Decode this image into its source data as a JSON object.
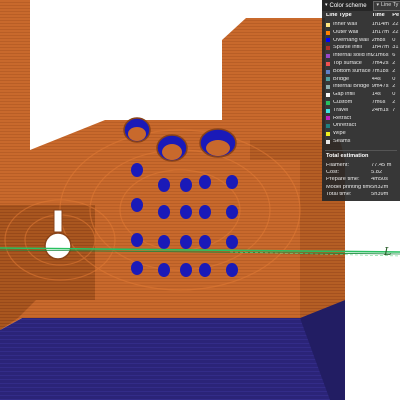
{
  "legend": {
    "title": "Color scheme",
    "selector_value": "Line Ty",
    "columns": [
      "Line Type",
      "Time",
      "Pe"
    ],
    "items": [
      {
        "label": "Inner wall",
        "time": "1h14m",
        "pct": "22",
        "color": "#ffe680"
      },
      {
        "label": "Outer wall",
        "time": "1h17m",
        "pct": "22",
        "color": "#ff7f00"
      },
      {
        "label": "Overhang wall",
        "time": "2m8s",
        "pct": "0",
        "color": "#0000ff"
      },
      {
        "label": "Sparse infill",
        "time": "1h47m",
        "pct": "31",
        "color": "#b03028"
      },
      {
        "label": "Internal solid infill",
        "time": "21m6s",
        "pct": "6",
        "color": "#9848c8"
      },
      {
        "label": "Top surface",
        "time": "7m42s",
        "pct": "2",
        "color": "#f05050"
      },
      {
        "label": "Bottom surface",
        "time": "7m18s",
        "pct": "2",
        "color": "#6080c8"
      },
      {
        "label": "Bridge",
        "time": "44s",
        "pct": "0",
        "color": "#50a0a0"
      },
      {
        "label": "Internal Bridge",
        "time": "9m47s",
        "pct": "2",
        "color": "#90b0b0"
      },
      {
        "label": "Gap infill",
        "time": "14s",
        "pct": "0",
        "color": "#f8f8f8"
      },
      {
        "label": "Custom",
        "time": "7m6s",
        "pct": "2",
        "color": "#28c060"
      },
      {
        "label": "Travel",
        "time": "24m1s",
        "pct": "7",
        "color": "#40e0e0"
      },
      {
        "label": "Retract",
        "time": "",
        "pct": "",
        "color": "#c020c0"
      },
      {
        "label": "Unretract",
        "time": "",
        "pct": "",
        "color": "#208080"
      },
      {
        "label": "Wipe",
        "time": "",
        "pct": "",
        "color": "#f0f020"
      },
      {
        "label": "Seams",
        "time": "",
        "pct": "",
        "color": "#e8e8e8"
      }
    ],
    "estimation": {
      "title": "Total estimation",
      "rows": [
        {
          "label": "Filament:",
          "value": "77.45 m"
        },
        {
          "label": "Cost:",
          "value": "5.82"
        },
        {
          "label": "Prepare time:",
          "value": "4m50s"
        },
        {
          "label": "Model printing time:",
          "value": "5h32m"
        },
        {
          "label": "Total time:",
          "value": "5h39m"
        }
      ]
    }
  },
  "viewport_label": "L",
  "colors": {
    "outer_wall": "#c8692c",
    "bottom_plate": "#2b2478",
    "overhang": "#1a1ab8",
    "custom_line": "#28c060"
  }
}
